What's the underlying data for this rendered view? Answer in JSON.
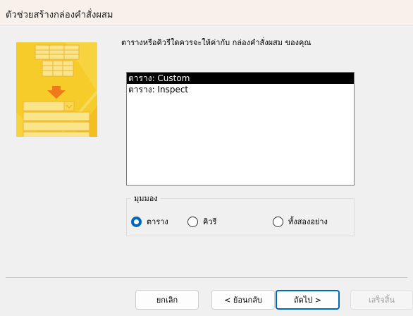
{
  "window": {
    "title": "ตัวช่วยสร้างกล่องคำสั่งผสม"
  },
  "prompt": "ตารางหรือคิวรีใดควรจะให้ค่ากับ กล่องคำสั่งผสม ของคุณ",
  "list": {
    "items": [
      {
        "label": "ตาราง: Custom",
        "selected": true
      },
      {
        "label": "ตาราง: Inspect",
        "selected": false
      }
    ]
  },
  "view": {
    "legend": "มุมมอง",
    "options": [
      {
        "label": "ตาราง",
        "checked": true
      },
      {
        "label": "คิวรี",
        "checked": false
      },
      {
        "label": "ทั้งสองอย่าง",
        "checked": false
      }
    ]
  },
  "buttons": {
    "cancel": "ยกเลิก",
    "back": "< ย้อนกลับ",
    "next": "ถัดไป >",
    "finish": "เสร็จสิ้น"
  },
  "colors": {
    "accent": "#0067c0",
    "illustration": "#f6cc2a",
    "selection": "#000000"
  }
}
